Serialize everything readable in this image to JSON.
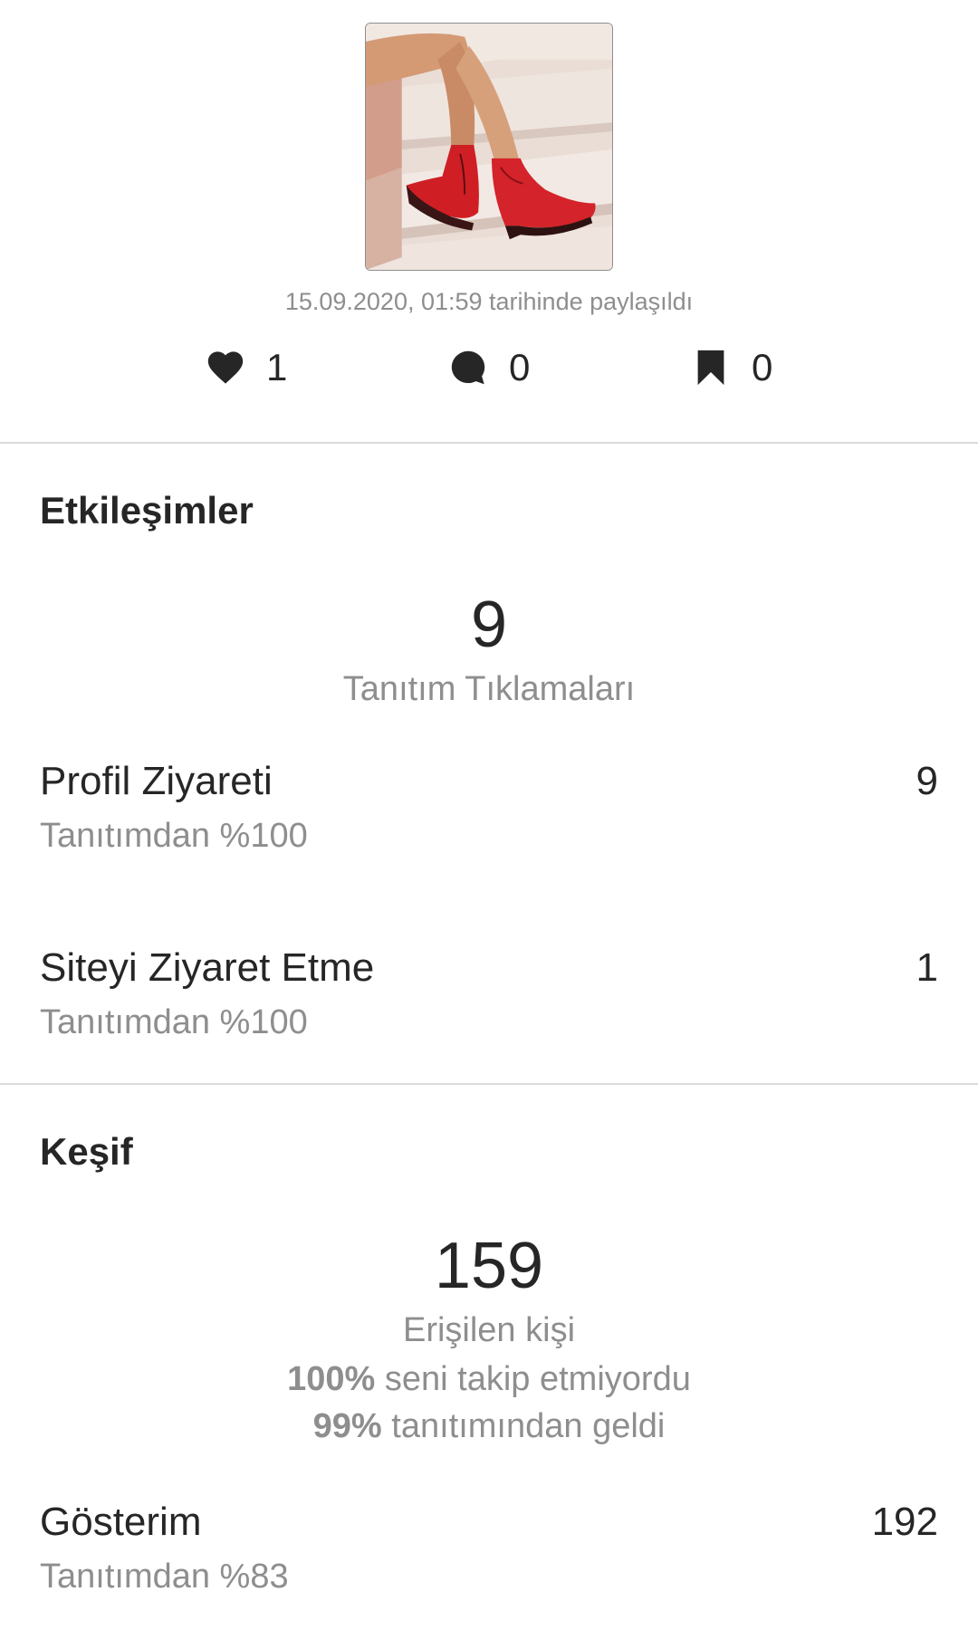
{
  "post": {
    "thumbnail": "red-boots-on-stairs-photo",
    "shared_date": "15.09.2020, 01:59 tarihinde paylaşıldı",
    "likes": "1",
    "comments": "0",
    "saves": "0",
    "icons": {
      "likes": "heart-icon",
      "comments": "comment-icon",
      "saves": "bookmark-icon"
    }
  },
  "interactions": {
    "title": "Etkileşimler",
    "total": "9",
    "total_caption": "Tanıtım Tıklamaları",
    "rows": [
      {
        "label": "Profil Ziyareti",
        "sub": "Tanıtımdan %100",
        "value": "9"
      },
      {
        "label": "Siteyi Ziyaret Etme",
        "sub": "Tanıtımdan %100",
        "value": "1"
      }
    ]
  },
  "discovery": {
    "title": "Keşif",
    "reach": "159",
    "reach_caption": "Erişilen kişi",
    "not_following_pct": "100%",
    "not_following_text": " seni takip etmiyordu",
    "from_promo_pct": "99%",
    "from_promo_text": " tanıtımından geldi",
    "rows": [
      {
        "label": "Gösterim",
        "sub": "Tanıtımdan %83",
        "value": "192"
      }
    ]
  },
  "colors": {
    "text_primary": "#262626",
    "text_secondary": "#8e8e8e",
    "divider": "#dbdbdb"
  }
}
